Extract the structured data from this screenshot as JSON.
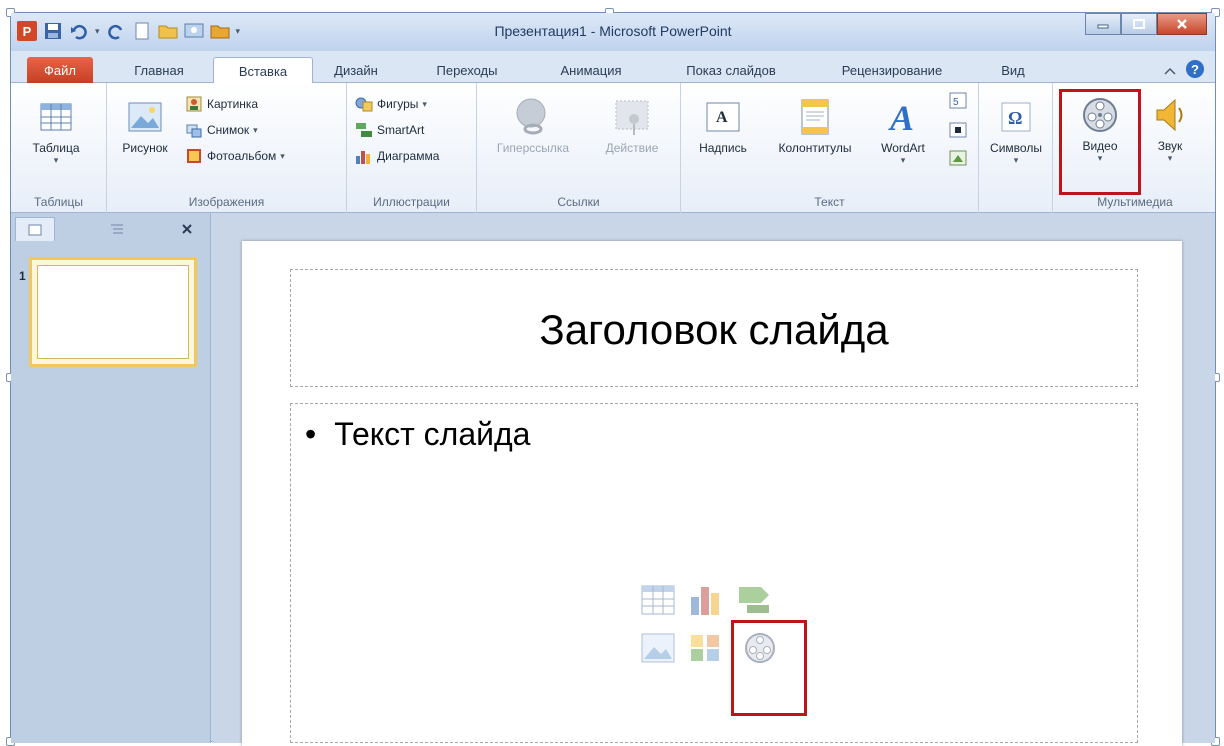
{
  "window": {
    "title": "Презентация1  -  Microsoft PowerPoint",
    "app_logo": "P"
  },
  "tabs": [
    {
      "label": "Файл"
    },
    {
      "label": "Главная"
    },
    {
      "label": "Вставка"
    },
    {
      "label": "Дизайн"
    },
    {
      "label": "Переходы"
    },
    {
      "label": "Анимация"
    },
    {
      "label": "Показ слайдов"
    },
    {
      "label": "Рецензирование"
    },
    {
      "label": "Вид"
    }
  ],
  "ribbon": {
    "tables": {
      "label": "Таблицы",
      "table_btn": "Таблица"
    },
    "images": {
      "label": "Изображения",
      "picture_btn": "Рисунок",
      "clipart_btn": "Картинка",
      "screenshot_btn": "Снимок",
      "album_btn": "Фотоальбом"
    },
    "illustrations": {
      "label": "Иллюстрации",
      "shapes_btn": "Фигуры",
      "smartart_btn": "SmartArt",
      "chart_btn": "Диаграмма"
    },
    "links": {
      "label": "Ссылки",
      "hyperlink_btn": "Гиперссылка",
      "action_btn": "Действие"
    },
    "text": {
      "label": "Текст",
      "textbox_btn": "Надпись",
      "header_btn": "Колонтитулы",
      "wordart_btn": "WordArt"
    },
    "symbols": {
      "symbols_btn": "Символы"
    },
    "media": {
      "label": "Мультимедиа",
      "video_btn": "Видео",
      "audio_btn": "Звук"
    }
  },
  "left_pane": {
    "slide_number": "1"
  },
  "slide": {
    "title": "Заголовок слайда",
    "bullet": "•",
    "body": "Текст слайда"
  },
  "colors": {
    "highlight": "#c0141b",
    "file_tab": "#c43f22"
  }
}
